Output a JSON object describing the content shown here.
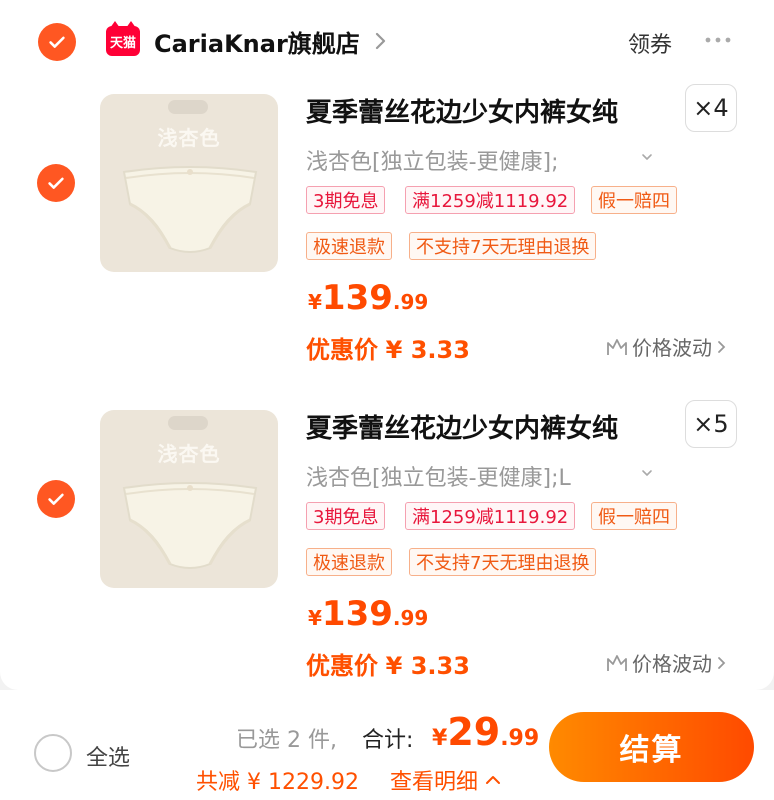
{
  "shop": {
    "logo_text": "天猫",
    "name": "CariaKnar旗舰店",
    "coupon_label": "领券"
  },
  "items": [
    {
      "thumb_label": "浅杏色",
      "title": "夏季蕾丝花边少女内裤女纯",
      "quantity": "×4",
      "sku": "浅杏色[独立包装-更健康];",
      "badges": [
        "3期免息",
        "满1259减1119.92",
        "假一赔四",
        "极速退款",
        "不支持7天无理由退换"
      ],
      "price_currency": "¥",
      "price_int": "139",
      "price_dec": ".99",
      "promo_label": "优惠价",
      "promo_value": "¥ 3.33",
      "trend_label": "价格波动"
    },
    {
      "thumb_label": "浅杏色",
      "title": "夏季蕾丝花边少女内裤女纯",
      "quantity": "×5",
      "sku": "浅杏色[独立包装-更健康];L",
      "badges": [
        "3期免息",
        "满1259减1119.92",
        "假一赔四",
        "极速退款",
        "不支持7天无理由退换"
      ],
      "price_currency": "¥",
      "price_int": "139",
      "price_dec": ".99",
      "promo_label": "优惠价",
      "promo_value": "¥ 3.33",
      "trend_label": "价格波动"
    }
  ],
  "footer": {
    "select_all": "全选",
    "selected_count": "已选 2 件,",
    "total_label": "合计:",
    "total_currency": "¥",
    "total_int": "29",
    "total_dec": ".99",
    "discount": "共减 ¥ 1229.92",
    "detail_link": "查看明细",
    "checkout": "结算"
  },
  "colors": {
    "accent": "#ff5722",
    "price": "#ff4a00",
    "tmall": "#ff0036"
  }
}
